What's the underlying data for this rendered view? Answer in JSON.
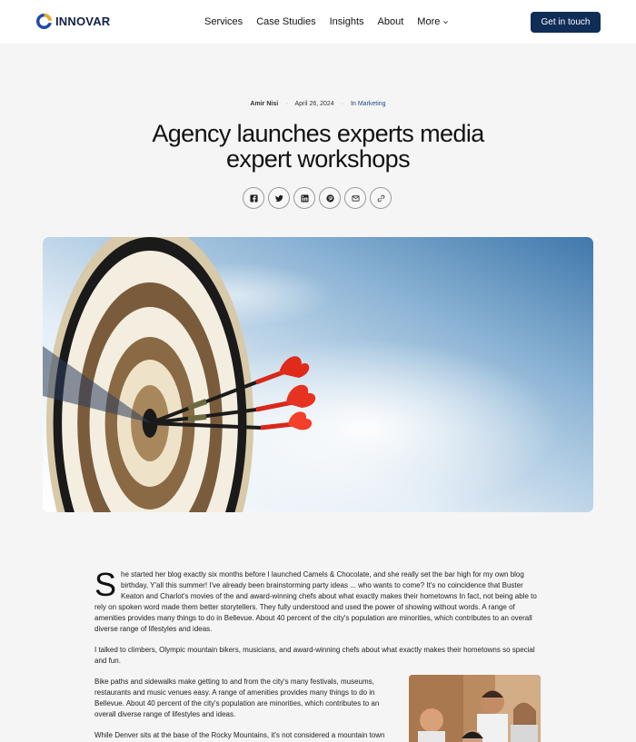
{
  "brand": {
    "name": "INNOVAR"
  },
  "nav": {
    "items": [
      "Services",
      "Case Studies",
      "Insights",
      "About"
    ],
    "more_label": "More"
  },
  "cta": {
    "label": "Get in touch"
  },
  "article": {
    "author": "Amir Nisi",
    "date": "April 26, 2024",
    "category_prefix": "In",
    "category": "Marketing",
    "title": "Agency launches experts media expert workshops",
    "dropcap": "S",
    "p1_rest": "he started her blog exactly six months before I launched Camels & Chocolate, and she really set the bar high for my own blog birthday, Y'all this summer! I've already been brainstorming party ideas ... who wants to come? It's no coincidence that Buster Keaton and Charlot's movies of the and award-winning chefs about what exactly makes their hometowns In fact, not being able to rely on spoken word made them better storytellers. They fully understood and used the power of showing without words. A range of amenities provides many things to do in Bellevue. About 40 percent of the city's population are minorities, which contributes to an overall diverse range of lifestyles and ideas.",
    "p2": "I talked to climbers, Olympic mountain bikers, musicians, and award-winning chefs about what exactly makes their hometowns so special and fun.",
    "p3": "Bike paths and sidewalks make getting to and from the city's many festivals, museums, restaurants and music venues easy. A range of amenities provides many things to do in Bellevue. About 40 percent of the city's population are minorities, which contributes to an overall diverse range of lifestyles and ideas.",
    "p4": "While Denver sits at the base of the Rocky Mountains, it's not considered a mountain town due to its large size, yet proximity to outdoor ski and recreation."
  },
  "share": {
    "icons": [
      "facebook-icon",
      "twitter-icon",
      "linkedin-icon",
      "pinterest-icon",
      "email-icon",
      "link-icon"
    ]
  },
  "colors": {
    "accent": "#0f2d57",
    "background": "#f5f5f5",
    "header": "#ffffff"
  }
}
